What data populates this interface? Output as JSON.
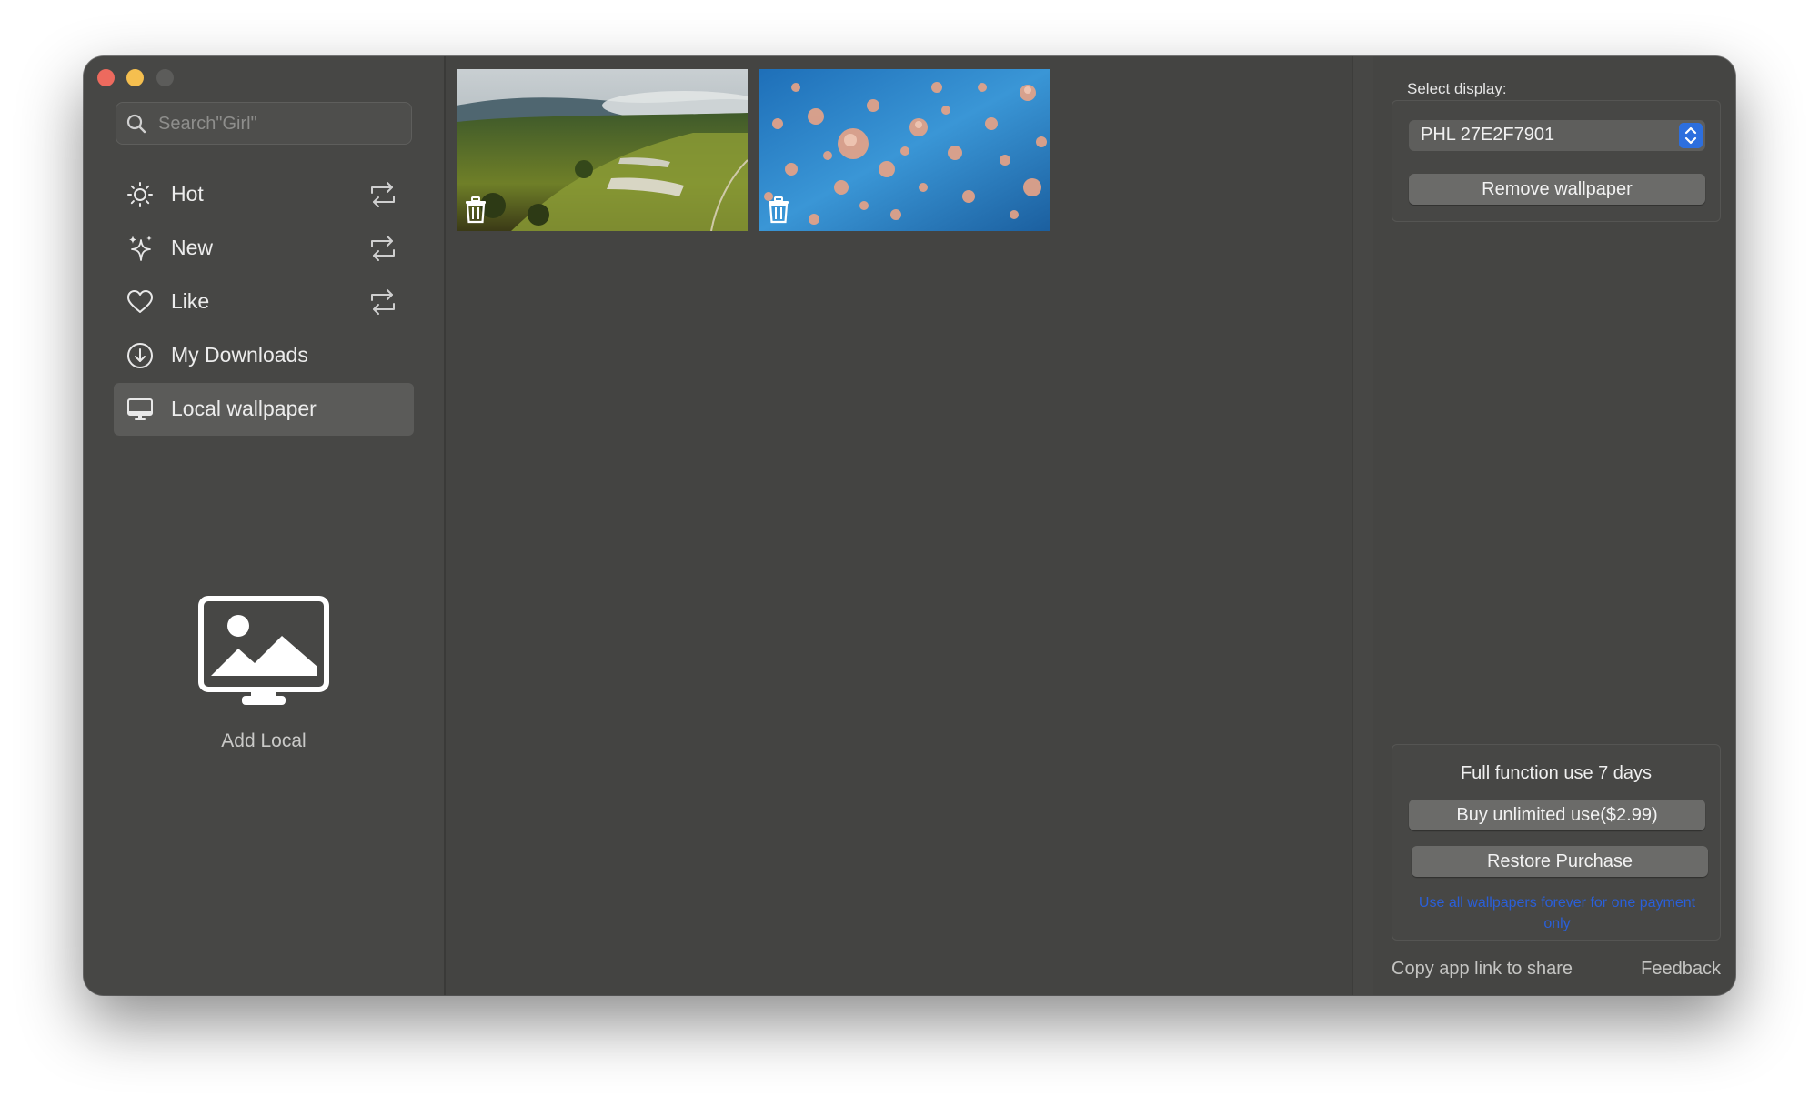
{
  "window": {
    "traffic_lights": {
      "close": "#ed6a5e",
      "minimize": "#f5bf4f",
      "zoom": "#5c5c5a"
    }
  },
  "sidebar": {
    "search": {
      "placeholder": "Search\"Girl\"",
      "icon": "search-icon"
    },
    "items": [
      {
        "label": "Hot",
        "icon": "sun-icon",
        "refresh": true,
        "active": false
      },
      {
        "label": "New",
        "icon": "sparkles-icon",
        "refresh": true,
        "active": false
      },
      {
        "label": "Like",
        "icon": "heart-icon",
        "refresh": true,
        "active": false
      },
      {
        "label": "My Downloads",
        "icon": "download-circle-icon",
        "refresh": false,
        "active": false
      },
      {
        "label": "Local wallpaper",
        "icon": "monitor-icon",
        "refresh": false,
        "active": true
      }
    ],
    "add_local": {
      "label": "Add Local",
      "icon": "monitor-photo-icon"
    }
  },
  "content": {
    "thumbnails": [
      {
        "subject": "aerial green hills with fog",
        "icon": "trash-icon"
      },
      {
        "subject": "jellyfish in blue water",
        "icon": "trash-icon"
      }
    ]
  },
  "right_panel": {
    "select_label": "Select display:",
    "display_value": "PHL 27E2F7901",
    "remove_button": "Remove wallpaper",
    "trial_text": "Full function use 7 days",
    "buy_button": "Buy unlimited use($2.99)",
    "restore_button": "Restore Purchase",
    "promo_link": "Use all wallpapers forever for one payment only",
    "share_link": "Copy app link to share",
    "feedback_link": "Feedback",
    "accent": "#2d6fde",
    "link_color": "#2a5fd8"
  }
}
